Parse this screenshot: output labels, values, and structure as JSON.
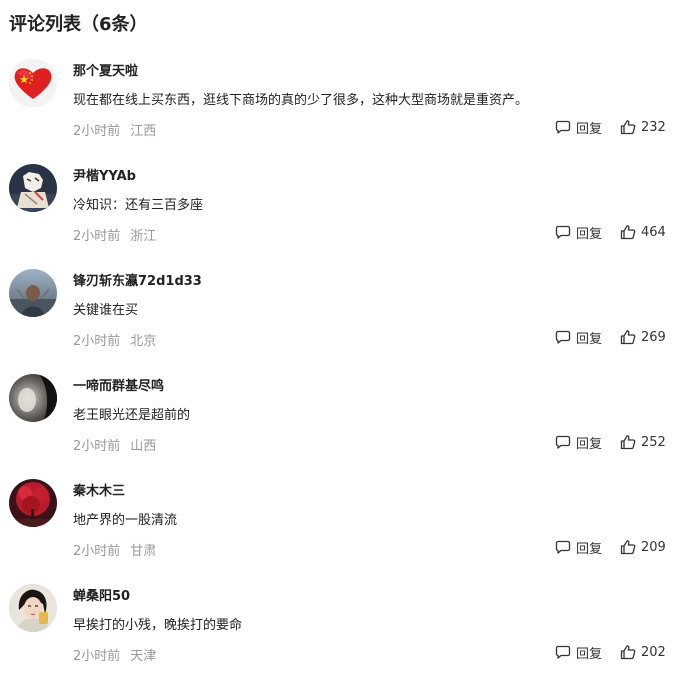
{
  "header": {
    "title": "评论列表（6条）"
  },
  "actions": {
    "reply_label": "回复",
    "reply_icon": "comment-bubble-icon",
    "like_icon": "thumbs-up-icon"
  },
  "comments": [
    {
      "username": "那个夏天啦",
      "content": "现在都在线上买东西，逛线下商场的真的少了很多，这种大型商场就是重资产。",
      "time": "2小时前",
      "location": "江西",
      "likes": "232",
      "avatar": "china-flag-heart-avatar"
    },
    {
      "username": "尹楷YYAb",
      "content": "冷知识：还有三百多座",
      "time": "2小时前",
      "location": "浙江",
      "likes": "464",
      "avatar": "cartoon-figure-avatar"
    },
    {
      "username": "锋刃斩东瀛72d1d33",
      "content": "关键谁在买",
      "time": "2小时前",
      "location": "北京",
      "likes": "269",
      "avatar": "person-photo-avatar"
    },
    {
      "username": "一啼而群基尽鸣",
      "content": "老王眼光还是超前的",
      "time": "2小时前",
      "location": "山西",
      "likes": "252",
      "avatar": "dark-portrait-avatar"
    },
    {
      "username": "秦木木三",
      "content": "地产界的一股清流",
      "time": "2小时前",
      "location": "甘肃",
      "likes": "209",
      "avatar": "red-tree-avatar"
    },
    {
      "username": "蝉桑阳50",
      "content": "早挨打的小残，晚挨打的要命",
      "time": "2小时前",
      "location": "天津",
      "likes": "202",
      "avatar": "woman-portrait-avatar"
    }
  ]
}
